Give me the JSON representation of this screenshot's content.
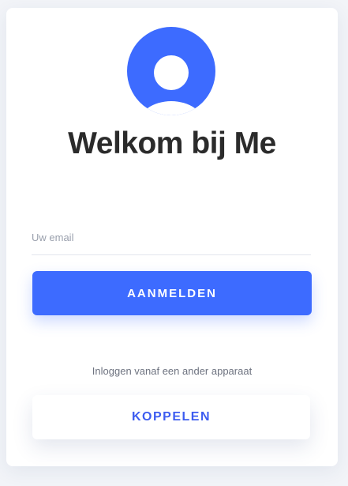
{
  "login": {
    "title": "Welkom bij Me",
    "email_placeholder": "Uw email",
    "email_value": "",
    "submit_label": "AANMELDEN",
    "other_device_text": "Inloggen vanaf een ander apparaat",
    "link_label": "KOPPELEN"
  },
  "icons": {
    "avatar": "user-avatar-icon"
  },
  "colors": {
    "accent": "#3d6bff",
    "link_text": "#3d5cf0",
    "title_text": "#2b2b2b",
    "background": "#f2f4f8"
  }
}
